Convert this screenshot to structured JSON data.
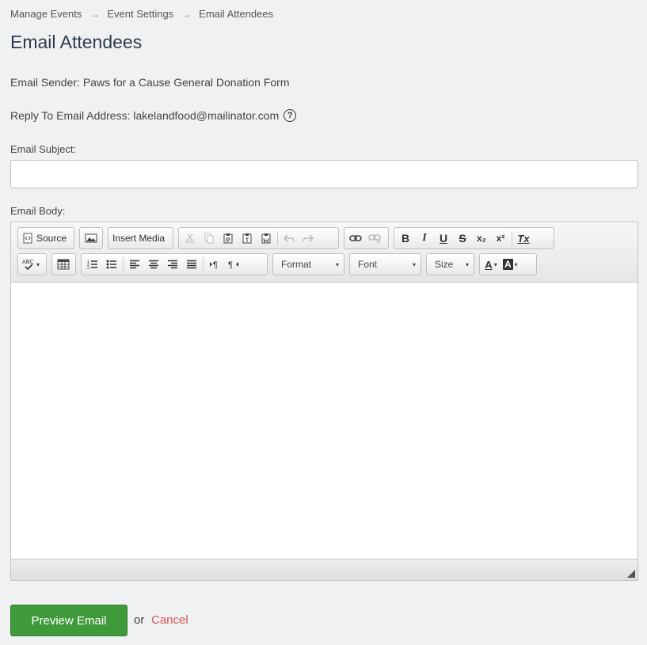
{
  "breadcrumb": {
    "items": [
      "Manage Events",
      "Event Settings",
      "Email Attendees"
    ],
    "separator": "→"
  },
  "page": {
    "title": "Email Attendees"
  },
  "info": {
    "sender_label": "Email Sender:",
    "sender_value": "Paws for a Cause General Donation Form",
    "reply_label": "Reply To Email Address:",
    "reply_value": "lakelandfood@mailinator.com",
    "help_glyph": "?"
  },
  "form": {
    "subject_label": "Email Subject:",
    "subject_value": "",
    "subject_placeholder": "",
    "body_label": "Email Body:"
  },
  "toolbar": {
    "source_label": "Source",
    "insert_media_label": "Insert Media",
    "bold": "B",
    "italic": "I",
    "underline": "U",
    "strike": "S",
    "subscript": "x₂",
    "superscript": "x²",
    "remove_format": "Tx",
    "format_label": "Format",
    "font_label": "Font",
    "size_label": "Size",
    "text_color": "A",
    "bg_color": "A",
    "spell": "ABC",
    "caret": "▾"
  },
  "icons": [
    "source-icon",
    "image-icon",
    "cut-icon",
    "copy-icon",
    "paste-icon",
    "paste-text-icon",
    "paste-word-icon",
    "undo-icon",
    "redo-icon",
    "link-icon",
    "unlink-icon",
    "spellcheck-icon",
    "table-icon",
    "numbered-list-icon",
    "bulleted-list-icon",
    "align-left-icon",
    "align-center-icon",
    "align-right-icon",
    "justify-icon",
    "ltr-icon",
    "rtl-icon",
    "resize-grip-icon"
  ],
  "actions": {
    "preview_label": "Preview Email",
    "or_text": "or",
    "cancel_label": "Cancel"
  },
  "colors": {
    "primary_green": "#3f9a3c",
    "cancel_red": "#d9534f",
    "title": "#2e3b4e"
  }
}
